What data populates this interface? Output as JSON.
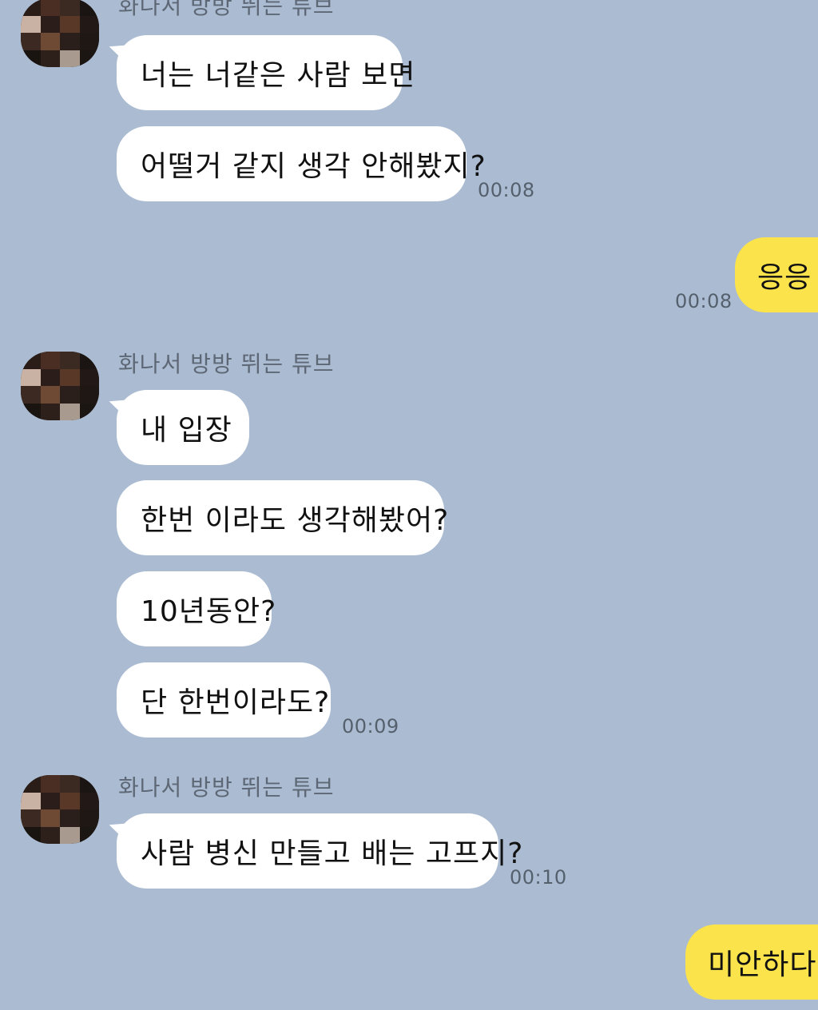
{
  "colors": {
    "background": "#abbcd2",
    "incoming_bubble": "#ffffff",
    "outgoing_bubble": "#fae34b"
  },
  "avatar_icon": "pixelated-avatar-icon",
  "groups": [
    {
      "sender": "화나서 방방 뛰는 튜브",
      "messages": [
        "너는 너같은 사람 보면",
        "어떨거 같지 생각 안해봤지?"
      ],
      "time": "00:08"
    },
    {
      "outgoing": true,
      "messages": [
        "응응"
      ],
      "time": "00:08"
    },
    {
      "sender": "화나서 방방 뛰는 튜브",
      "messages": [
        "내 입장",
        "한번 이라도 생각해봤어?",
        "10년동안?",
        "단 한번이라도?"
      ],
      "time": "00:09"
    },
    {
      "sender": "화나서 방방 뛰는 튜브",
      "messages": [
        "사람 병신 만들고 배는 고프지?"
      ],
      "time": "00:10"
    },
    {
      "outgoing": true,
      "messages": [
        "미안하다"
      ]
    }
  ]
}
